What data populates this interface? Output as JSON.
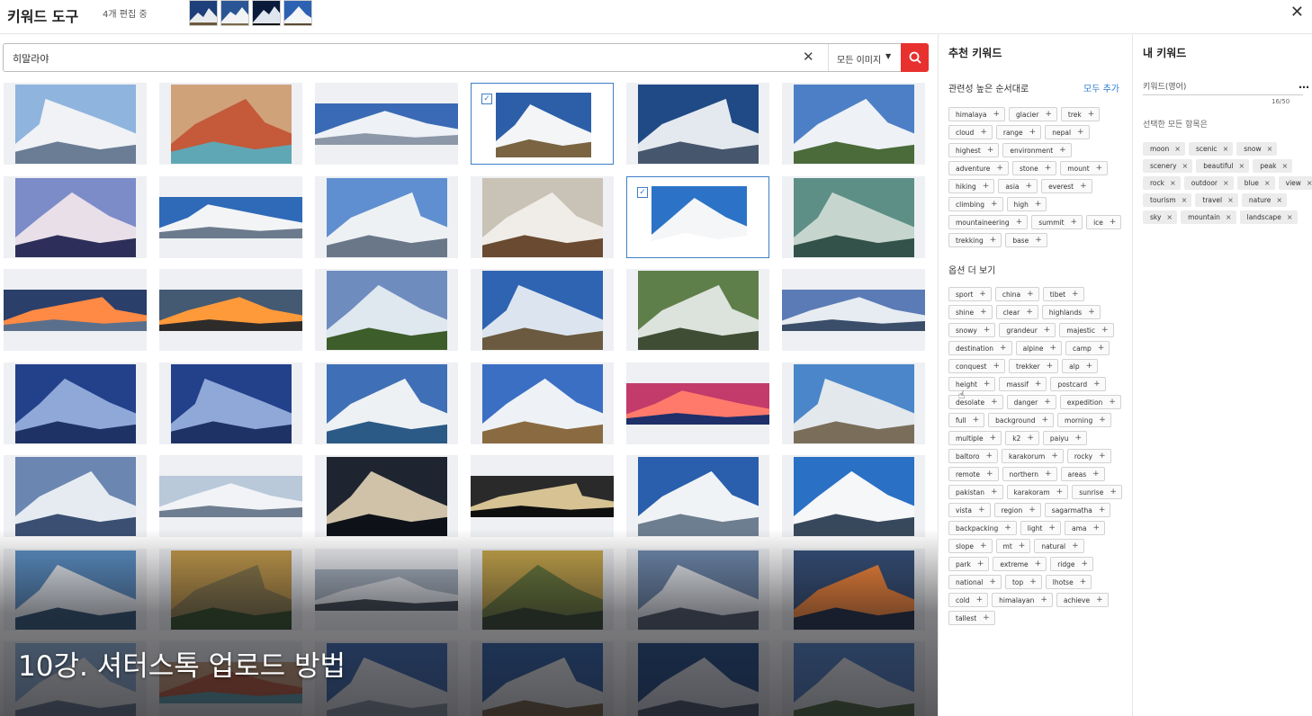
{
  "header": {
    "title": "키워드 도구",
    "editing": "4개 편집 중",
    "close_icon": "close-icon"
  },
  "search": {
    "query": "히말라야",
    "filter": "모든 이미지",
    "clear_icon": "clear-icon",
    "search_icon": "search-icon"
  },
  "recommended": {
    "title": "추천 키워드",
    "relevance_label": "관련성 높은 순서대로",
    "add_all": "모두 추가",
    "keywords": [
      "himalaya",
      "glacier",
      "trek",
      "cloud",
      "range",
      "nepal",
      "highest",
      "environment",
      "adventure",
      "stone",
      "mount",
      "hiking",
      "asia",
      "everest",
      "climbing",
      "high",
      "mountaineering",
      "summit",
      "ice",
      "trekking",
      "base"
    ],
    "more_label": "옵션 더 보기",
    "more_keywords": [
      "sport",
      "china",
      "tibet",
      "shine",
      "clear",
      "highlands",
      "snowy",
      "grandeur",
      "majestic",
      "destination",
      "alpine",
      "camp",
      "conquest",
      "trekker",
      "alp",
      "height",
      "massif",
      "postcard",
      "desolate",
      "danger",
      "expedition",
      "full",
      "background",
      "morning",
      "multiple",
      "k2",
      "paiyu",
      "baltoro",
      "karakorum",
      "rocky",
      "remote",
      "northern",
      "areas",
      "pakistan",
      "karakoram",
      "sunrise",
      "vista",
      "region",
      "sagarmatha",
      "backpacking",
      "light",
      "ama",
      "slope",
      "mt",
      "natural",
      "park",
      "extreme",
      "ridge",
      "national",
      "top",
      "lhotse",
      "cold",
      "himalayan",
      "achieve",
      "tallest"
    ]
  },
  "my_keywords": {
    "title": "내 키워드",
    "input_label": "키워드(영어)",
    "count": "16/50",
    "select_all": "선택한 모든 항목은",
    "keywords": [
      "moon",
      "scenic",
      "snow",
      "scenery",
      "beautiful",
      "peak",
      "rock",
      "outdoor",
      "blue",
      "view",
      "tourism",
      "travel",
      "nature",
      "sky",
      "mountain",
      "landscape"
    ]
  },
  "caption": "10강. 셔터스톡 업로드 방법"
}
